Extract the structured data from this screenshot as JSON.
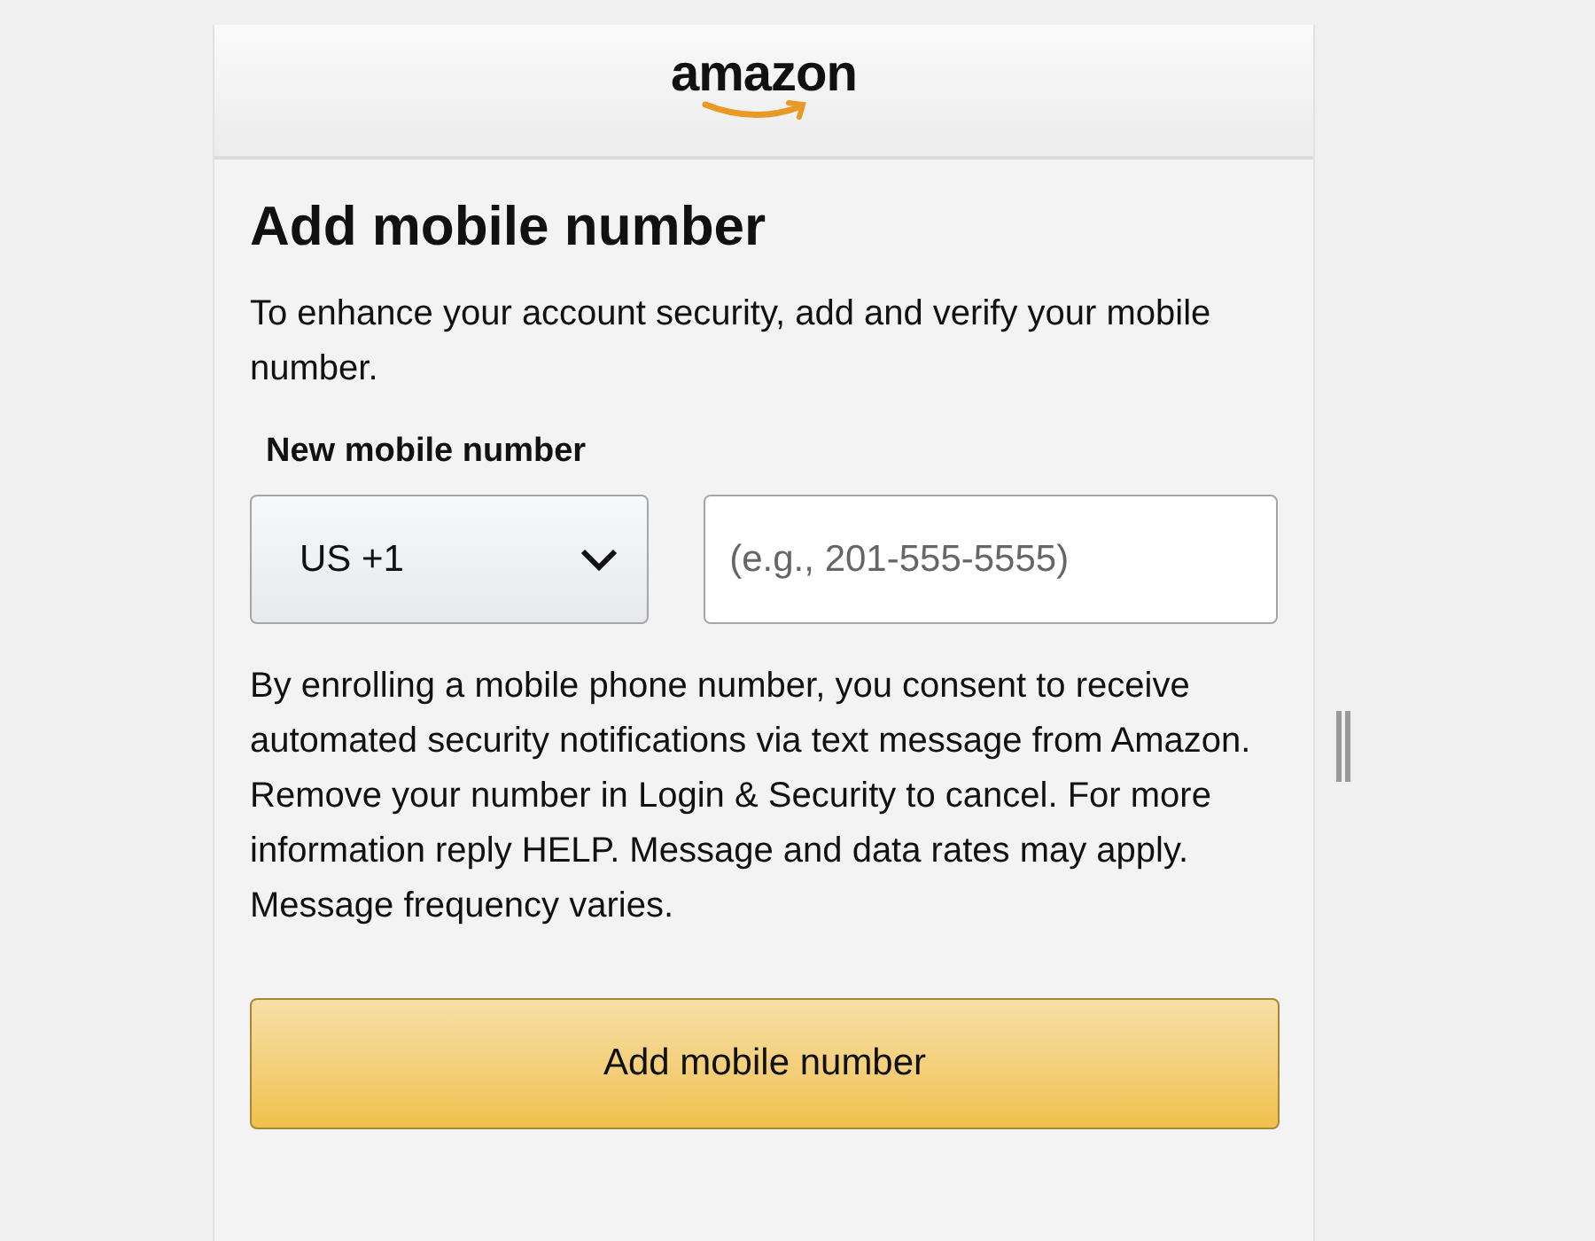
{
  "header": {
    "logo": "amazon"
  },
  "title": "Add mobile number",
  "description": "To enhance your account security, add and verify your mobile number.",
  "phone": {
    "label": "New mobile number",
    "country_code": "US +1",
    "placeholder": "(e.g., 201-555-5555)"
  },
  "consent": "By enrolling a mobile phone number, you consent to receive automated security notifications via text message from Amazon. Remove your number in Login & Security to cancel. For more information reply HELP. Message and data rates may apply. Message frequency varies.",
  "submit_button": "Add mobile number"
}
